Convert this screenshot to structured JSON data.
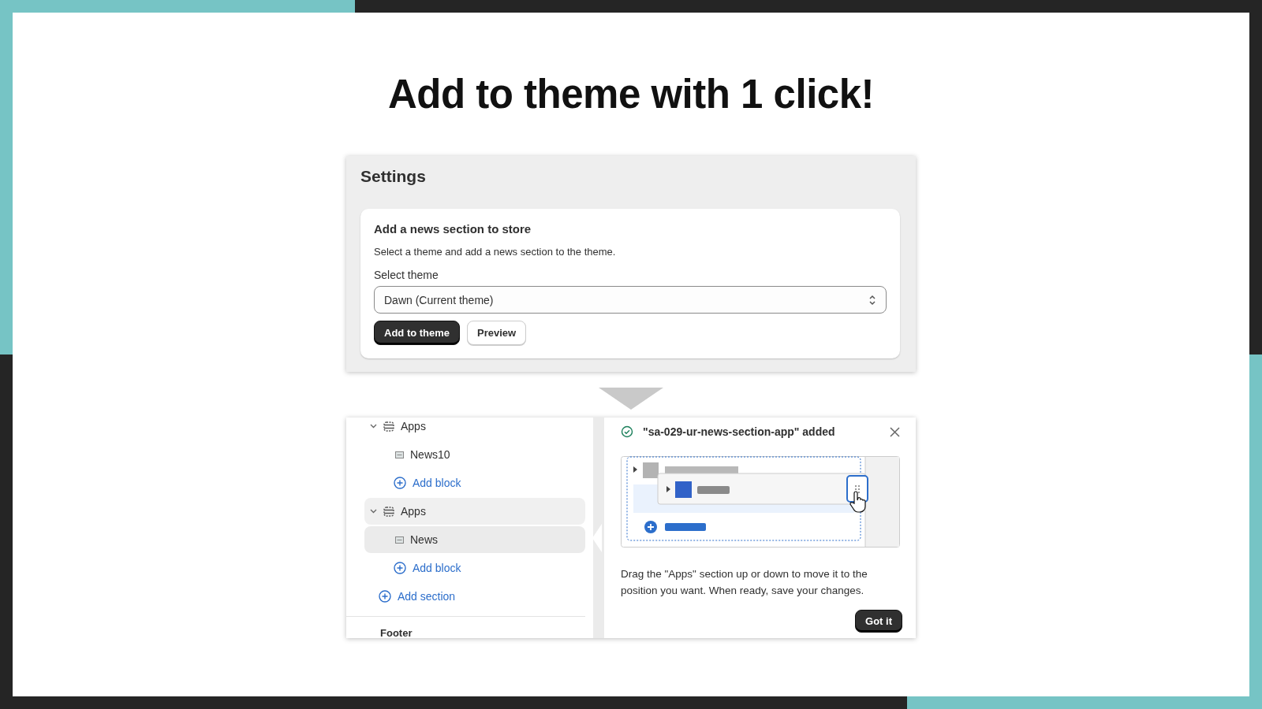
{
  "title": "Add to theme with 1 click!",
  "settings": {
    "heading": "Settings",
    "card_title": "Add a news section to store",
    "description": "Select a theme and add a news section to the theme.",
    "select_label": "Select theme",
    "select_value": "Dawn (Current theme)",
    "buttons": [
      {
        "label": "Add to theme",
        "kind": "primary"
      },
      {
        "label": "Preview",
        "kind": "secondary"
      }
    ]
  },
  "editor": {
    "tree": [
      {
        "label": "Apps",
        "kind": "section",
        "expanded": true,
        "selected": false,
        "children": [
          {
            "label": "News10",
            "kind": "block",
            "selected": false
          },
          {
            "label": "Add block",
            "kind": "add"
          }
        ]
      },
      {
        "label": "Apps",
        "kind": "section",
        "expanded": true,
        "selected": true,
        "children": [
          {
            "label": "News",
            "kind": "block",
            "selected": true
          },
          {
            "label": "Add block",
            "kind": "add"
          }
        ]
      },
      {
        "label": "Add section",
        "kind": "add"
      }
    ],
    "group_heading": "Footer",
    "toast": {
      "message": "\"sa-029-ur-news-section-app\" added",
      "hint": "Drag the \"Apps\" section up or down to move it to the position you want. When ready, save your changes.",
      "button": "Got it"
    }
  }
}
